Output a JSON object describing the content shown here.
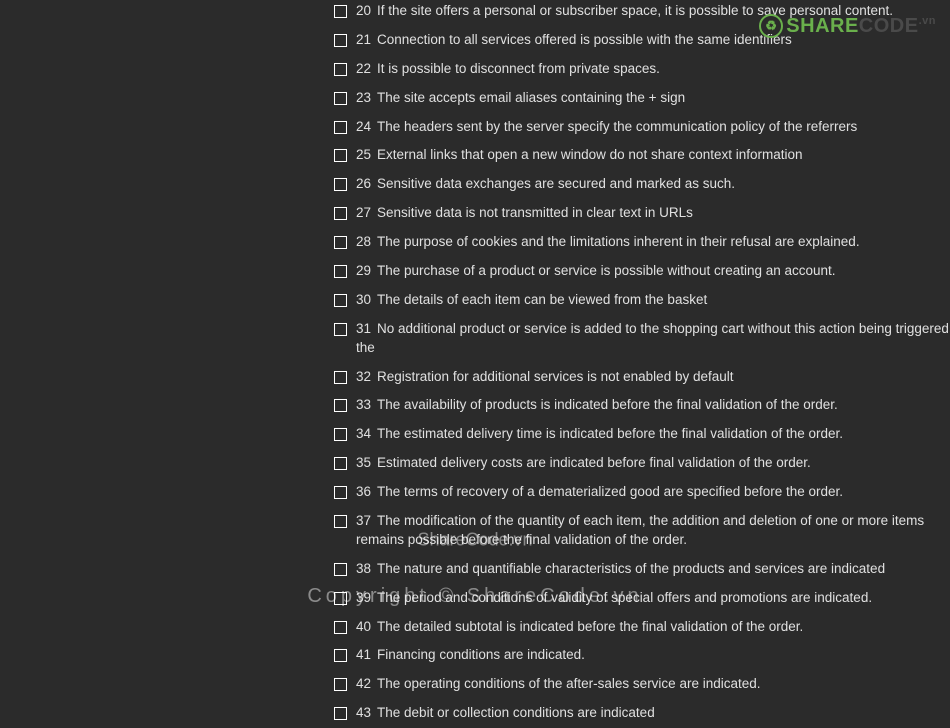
{
  "checklist": {
    "items": [
      {
        "num": "20",
        "label": "If the site offers a personal or subscriber space, it is possible to save personal content."
      },
      {
        "num": "21",
        "label": "Connection to all services offered is possible with the same identifiers"
      },
      {
        "num": "22",
        "label": "It is possible to disconnect from private spaces."
      },
      {
        "num": "23",
        "label": "The site accepts email aliases containing the + sign"
      },
      {
        "num": "24",
        "label": "The headers sent by the server specify the communication policy of the referrers"
      },
      {
        "num": "25",
        "label": "External links that open a new window do not share context information"
      },
      {
        "num": "26",
        "label": "Sensitive data exchanges are secured and marked as such."
      },
      {
        "num": "27",
        "label": "Sensitive data is not transmitted in clear text in URLs"
      },
      {
        "num": "28",
        "label": "The purpose of cookies and the limitations inherent in their refusal are explained."
      },
      {
        "num": "29",
        "label": "The purchase of a product or service is possible without creating an account."
      },
      {
        "num": "30",
        "label": "The details of each item can be viewed from the basket"
      },
      {
        "num": "31",
        "label": "No additional product or service is added to the shopping cart without this action being triggered by the"
      },
      {
        "num": "32",
        "label": "Registration for additional services is not enabled by default"
      },
      {
        "num": "33",
        "label": "The availability of products is indicated before the final validation of the order."
      },
      {
        "num": "34",
        "label": "The estimated delivery time is indicated before the final validation of the order."
      },
      {
        "num": "35",
        "label": "Estimated delivery costs are indicated before final validation of the order."
      },
      {
        "num": "36",
        "label": "The terms of recovery of a dematerialized good are specified before the order."
      },
      {
        "num": "37",
        "label": "The modification of the quantity of each item, the addition and deletion of one or more items remains possible before the final validation of the order."
      },
      {
        "num": "38",
        "label": "The nature and quantifiable characteristics of the products and services are indicated"
      },
      {
        "num": "39",
        "label": "The period and conditions of validity of special offers and promotions are indicated."
      },
      {
        "num": "40",
        "label": "The detailed subtotal is indicated before the final validation of the order."
      },
      {
        "num": "41",
        "label": "Financing conditions are indicated."
      },
      {
        "num": "42",
        "label": "The operating conditions of the after-sales service are indicated."
      },
      {
        "num": "43",
        "label": "The debit or collection conditions are indicated"
      }
    ]
  },
  "watermark": {
    "logo_share": "SHARE",
    "logo_code": "CODE",
    "logo_vn": ".vn",
    "center": "ShareCode.vn",
    "copyright": "Copyright © ShareCode.vn"
  }
}
